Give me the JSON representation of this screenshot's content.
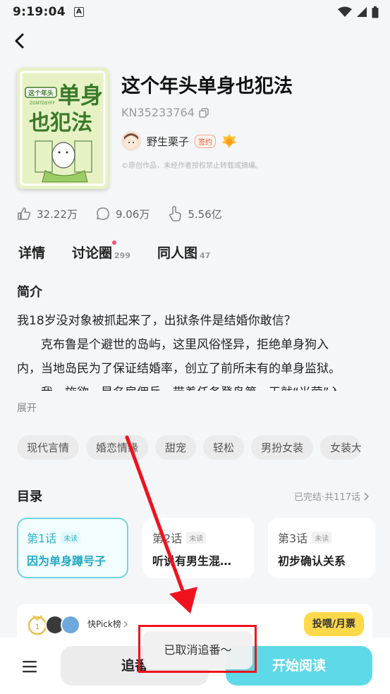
{
  "status_bar": {
    "time": "9:19:04",
    "notification_badge": "A"
  },
  "book": {
    "title": "这个年头单身也犯法",
    "id": "KN35233764",
    "author": "野生栗子",
    "signed_badge": "签约",
    "copyright": "©原创作品，未经作者授权禁止转载或摘编。",
    "cover_text": {
      "small": "这个年头",
      "big1": "单身",
      "big2": "也犯法",
      "pinyin": "ZGNTDSYFF"
    }
  },
  "stats": [
    {
      "icon": "thumbs-up-icon",
      "value": "32.22万"
    },
    {
      "icon": "comment-bubble-icon",
      "value": "9.06万"
    },
    {
      "icon": "pointer-hand-icon",
      "value": "5.56亿"
    }
  ],
  "tabs": [
    {
      "label": "详情",
      "count": "",
      "active": true
    },
    {
      "label": "讨论圈",
      "count": "299",
      "active": false
    },
    {
      "label": "同人图",
      "count": "47",
      "active": false
    }
  ],
  "intro": {
    "heading": "简介",
    "lines": [
      "我18岁没对象被抓起来了，出狱条件是结婚你敢信？",
      "克布鲁是个避世的岛屿，这里风俗怪异，拒绝单身狗入",
      "内，当地岛民为了保证结婚率，创立了前所未有的单身监狱。",
      "我，施欲，是名雇佣兵，带着任务登岛第一天就“光荣”入"
    ],
    "expand": "展开"
  },
  "tags": [
    "现代言情",
    "婚恋情缘",
    "甜宠",
    "轻松",
    "男扮女装",
    "女装大佬"
  ],
  "toc": {
    "heading": "目录",
    "status": "已完结·共117话",
    "chapters": [
      {
        "num": "第1话",
        "badge": "未读",
        "title": "因为单身蹲号子",
        "active": true
      },
      {
        "num": "第2话",
        "badge": "未读",
        "title": "听说有男生混…",
        "active": false
      },
      {
        "num": "第3话",
        "badge": "未读",
        "title": "初步确认关系",
        "active": false
      }
    ]
  },
  "pick": {
    "label": "快Pick榜",
    "vote_button": "投喂/月票"
  },
  "bottom": {
    "follow_button": "追番",
    "read_button": "开始阅读"
  },
  "toast": "已取消追番～",
  "colors": {
    "accent": "#5ed9e8",
    "annotation": "#f0121e",
    "vote": "#ffd94a"
  }
}
